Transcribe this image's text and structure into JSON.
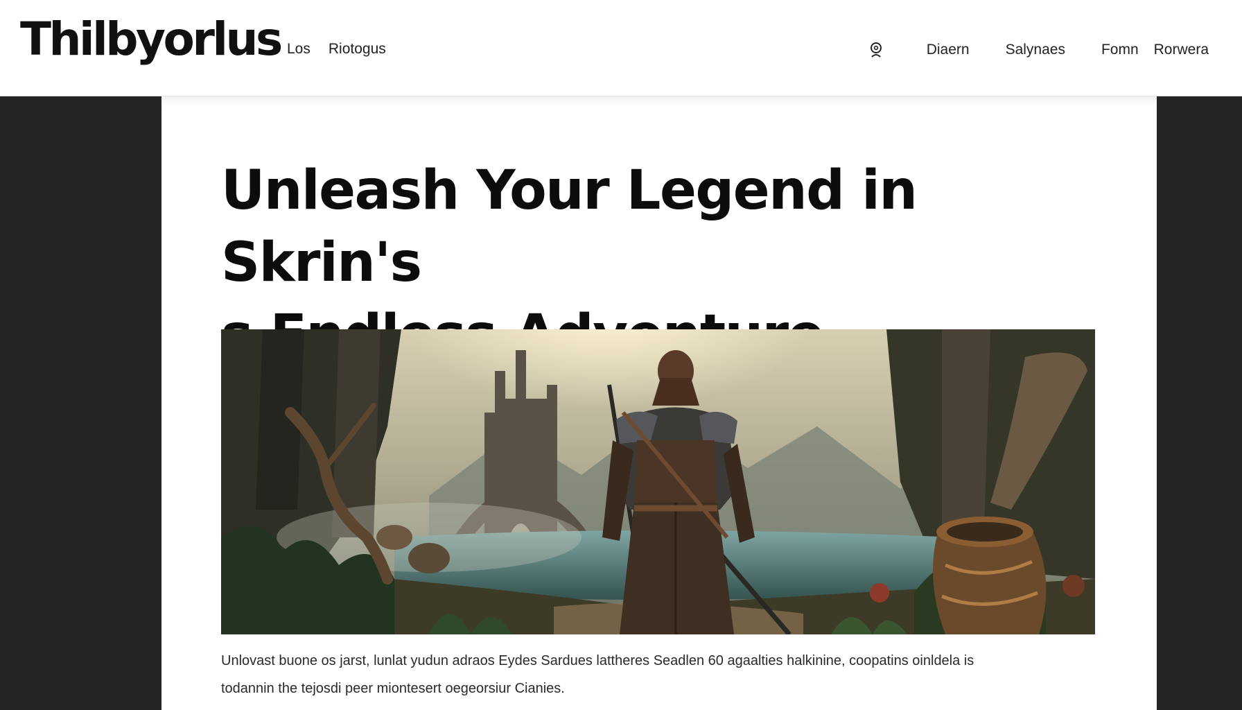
{
  "site": {
    "logo": "Thilbyorlus"
  },
  "nav": {
    "left_links": [
      "Los",
      "Riotogus"
    ],
    "right_links": [
      "Diaern",
      "Salynaes",
      "Fomn",
      "Rorwera"
    ],
    "search_icon": "search-icon"
  },
  "article": {
    "headline_line1": "Unleash Your Legend in Skrin's",
    "headline_line2": "s Endless Adventure",
    "hero_image": "fantasy warrior with sword in forest ruins",
    "body_line1": "Unlovast buone os jarst, lunlat yudun adraos Eydes Sardues lattheres Seadlen 60 agaalties halkinine, coopatins oinldela is",
    "body_line2": "todannin the tejosdi peer miontesert oegeorsiur Cianies."
  },
  "colors": {
    "page_background": "#242424",
    "header_background": "#ffffff",
    "text": "#111111"
  }
}
